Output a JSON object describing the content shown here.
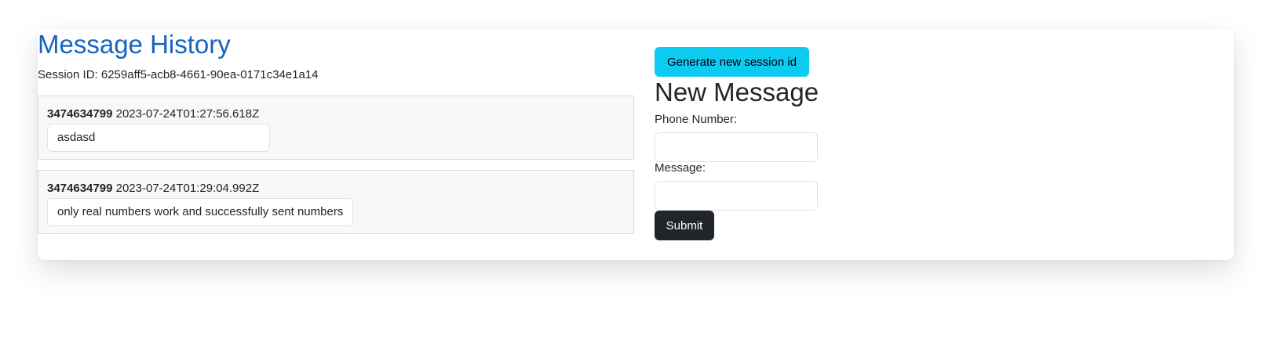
{
  "history": {
    "title": "Message History",
    "session_label": "Session ID:",
    "session_id": "6259aff5-acb8-4661-90ea-0171c34e1a14",
    "messages": [
      {
        "phone": "3474634799",
        "timestamp": "2023-07-24T01:27:56.618Z",
        "body": "asdasd"
      },
      {
        "phone": "3474634799",
        "timestamp": "2023-07-24T01:29:04.992Z",
        "body": "only real numbers work and successfully sent numbers"
      }
    ]
  },
  "form": {
    "generate_button": "Generate new session id",
    "title": "New Message",
    "phone_label": "Phone Number:",
    "phone_value": "",
    "message_label": "Message:",
    "message_value": "",
    "submit_button": "Submit"
  },
  "colors": {
    "title_blue": "#1565c0",
    "generate_button_bg": "#0dcaf0",
    "submit_button_bg": "#212529",
    "message_box_bg": "#f8f8f8"
  }
}
